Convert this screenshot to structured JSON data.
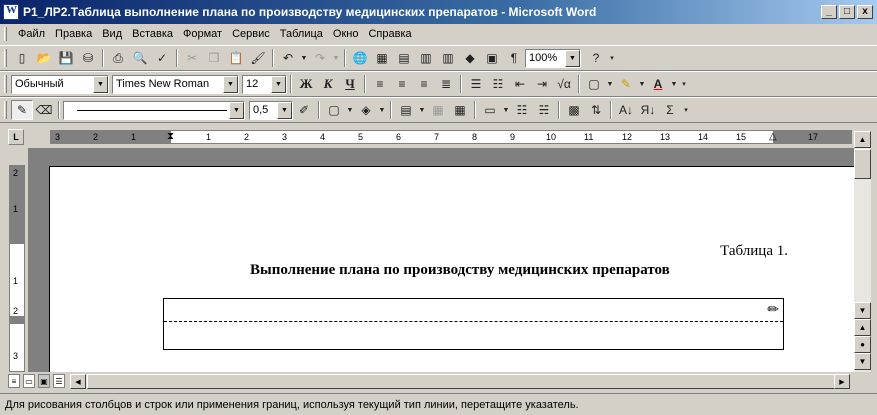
{
  "window": {
    "title": "P1_ЛР2.Таблица выполнение плана по производству медицинских препаратов - Microsoft Word",
    "minimize_label": "_",
    "maximize_label": "□",
    "close_label": "x"
  },
  "menu": {
    "items": [
      "Файл",
      "Правка",
      "Вид",
      "Вставка",
      "Формат",
      "Сервис",
      "Таблица",
      "Окно",
      "Справка"
    ]
  },
  "standard_toolbar": {
    "zoom": "100%"
  },
  "formatting_toolbar": {
    "style": "Обычный",
    "font": "Times New Roman",
    "size": "12",
    "bold_label": "Ж",
    "italic_label": "К",
    "underline_label": "Ч"
  },
  "tables_toolbar": {
    "line_weight": "0,5",
    "sum_label": "Σ"
  },
  "ruler": {
    "h_numbers": [
      "3",
      "2",
      "1",
      "1",
      "2",
      "3",
      "4",
      "5",
      "6",
      "7",
      "8",
      "9",
      "10",
      "11",
      "12",
      "13",
      "14",
      "15",
      "17"
    ],
    "v_numbers": [
      "2",
      "1",
      "1",
      "2",
      "3"
    ]
  },
  "document": {
    "caption": "Таблица 1.",
    "title": "Выполнение плана по производству медицинских препаратов"
  },
  "status": {
    "text": "Для рисования столбцов и строк или применения границ, используя текущий тип линии, перетащите указатель."
  },
  "colors": {
    "title_bar": "#0a246a",
    "face": "#d4d0c8",
    "page": "#ffffff",
    "highlight": "#ffff00",
    "font_color": "#ff0000"
  }
}
